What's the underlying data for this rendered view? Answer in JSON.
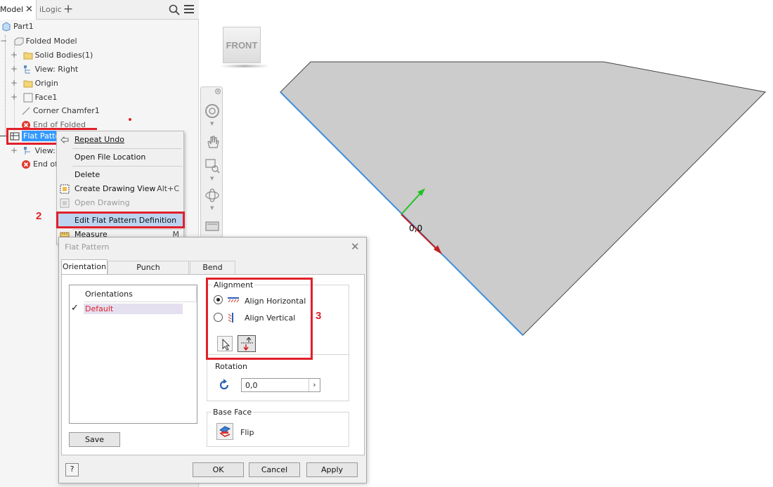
{
  "browser": {
    "tabs": [
      "Model",
      "iLogic"
    ],
    "tree": [
      {
        "label": "Part1",
        "icon": "part-icon"
      },
      {
        "label": "Folded Model",
        "icon": "folded-model-icon"
      },
      {
        "label": "Solid Bodies(1)",
        "icon": "folder-icon"
      },
      {
        "label": "View: Right",
        "icon": "view-icon"
      },
      {
        "label": "Origin",
        "icon": "folder-icon"
      },
      {
        "label": "Face1",
        "icon": "face-icon"
      },
      {
        "label": "Corner Chamfer1",
        "icon": "chamfer-icon"
      },
      {
        "label": "End of Folded",
        "icon": "end-marker-icon"
      },
      {
        "label": "Flat Patte",
        "icon": "flat-pattern-icon"
      },
      {
        "label": "View: I",
        "icon": "view-icon"
      },
      {
        "label": "End of",
        "icon": "end-marker-icon"
      }
    ]
  },
  "context_menu": {
    "items": [
      {
        "label": "Repeat Undo",
        "shortcut": ""
      },
      {
        "label": "Open File Location",
        "shortcut": ""
      },
      {
        "label": "Delete",
        "shortcut": ""
      },
      {
        "label": "Create Drawing View",
        "shortcut": "Alt+C"
      },
      {
        "label": "Open Drawing",
        "shortcut": ""
      },
      {
        "label": "Edit Flat Pattern Definition",
        "shortcut": ""
      },
      {
        "label": "Measure",
        "shortcut": "M"
      }
    ]
  },
  "annotations": {
    "step2": "2",
    "step3": "3"
  },
  "dialog": {
    "title": "Flat Pattern",
    "tabs": [
      "Orientation",
      "Punch Representation",
      "Bend Angle"
    ],
    "orientations_header": "Orientations",
    "orientations": [
      "Default"
    ],
    "alignment_label": "Alignment",
    "align_horizontal": "Align Horizontal",
    "align_vertical": "Align Vertical",
    "rotation_label": "Rotation",
    "rotation_value": "0,0",
    "base_face_label": "Base Face",
    "flip_label": "Flip",
    "buttons": {
      "save": "Save",
      "ok": "OK",
      "cancel": "Cancel",
      "apply": "Apply"
    }
  },
  "viewport": {
    "viewcube_label": "FRONT",
    "origin_label": "0,0",
    "part_fill": "#cccccc",
    "edge_highlight": "#3b8fe0"
  },
  "colors": {
    "annotation_red": "#e0202a",
    "selection_blue": "#3399ff",
    "menu_highlight": "#bcd4f0"
  }
}
